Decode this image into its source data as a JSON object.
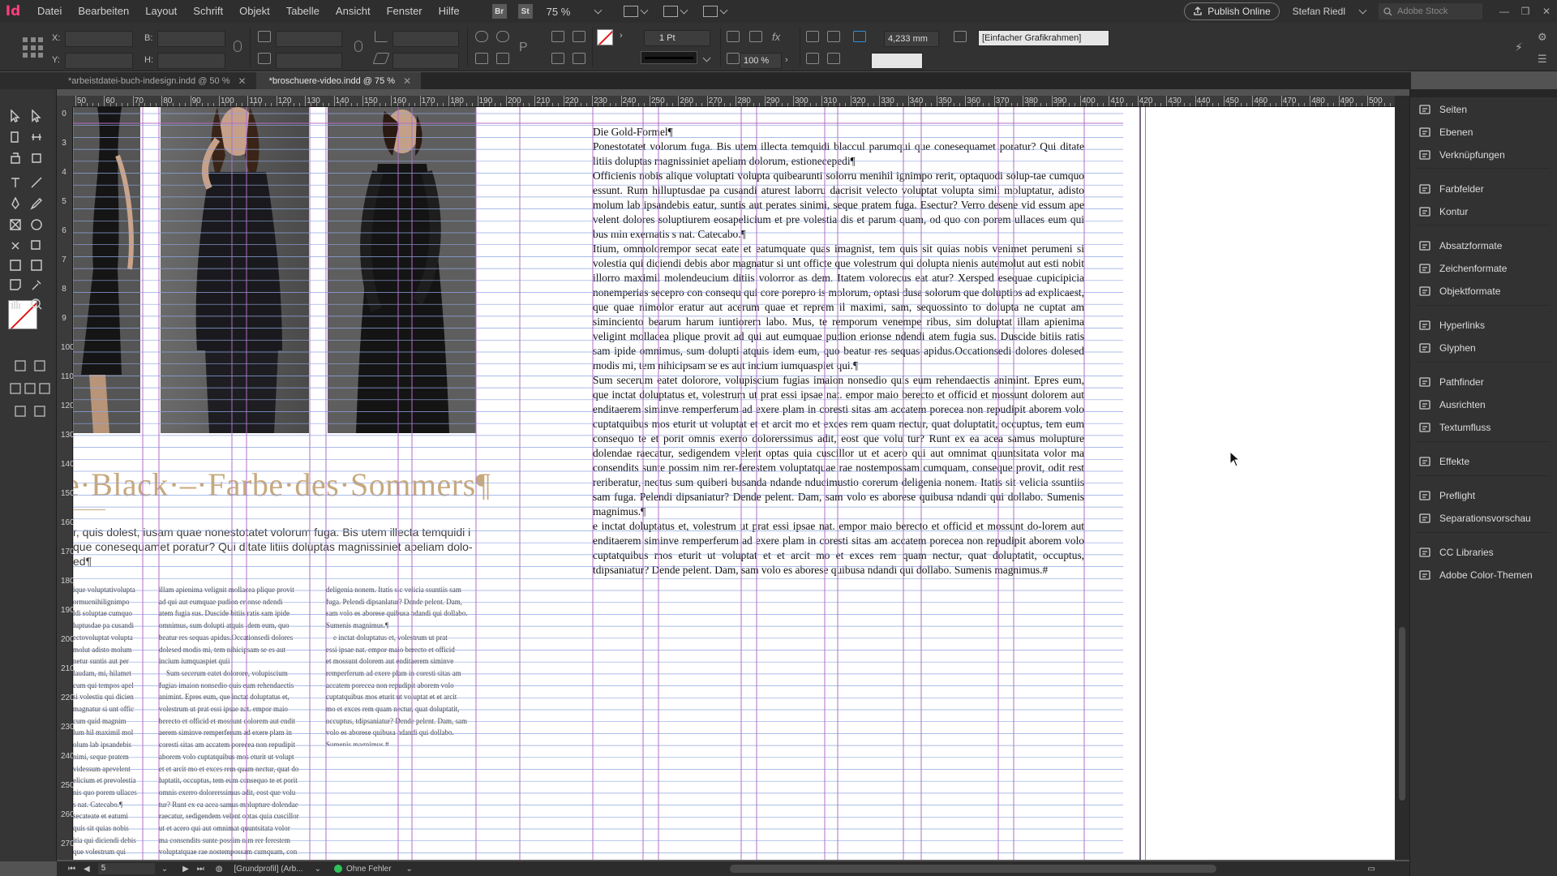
{
  "app": {
    "logo": "Id"
  },
  "menu": [
    "Datei",
    "Bearbeiten",
    "Layout",
    "Schrift",
    "Objekt",
    "Tabelle",
    "Ansicht",
    "Fenster",
    "Hilfe"
  ],
  "menubar": {
    "bridge_badge": "Br",
    "stock_badge": "St",
    "zoom": "75 %",
    "publish": "Publish Online",
    "user": "Stefan Riedl",
    "stock_placeholder": "Adobe Stock"
  },
  "control": {
    "x_label": "X:",
    "y_label": "Y:",
    "b_label": "B:",
    "h_label": "H:",
    "stroke_weight": "1 Pt",
    "scale": "100 %",
    "offset": "4,233 mm",
    "style": "[Einfacher Grafikrahmen]"
  },
  "tabs": [
    {
      "label": "*arbeistdatei-buch-indesign.indd @ 50 %",
      "active": false
    },
    {
      "label": "*broschuere-video.indd @ 75 %",
      "active": true
    }
  ],
  "ruler_top": [
    "50",
    "60",
    "70",
    "80",
    "90",
    "100",
    "110",
    "120",
    "130",
    "140",
    "150",
    "160",
    "170",
    "180",
    "190",
    "200",
    "210",
    "220",
    "230",
    "240",
    "250",
    "260",
    "270",
    "280",
    "290",
    "300",
    "310",
    "320",
    "330",
    "340",
    "350",
    "360",
    "370",
    "380",
    "390",
    "400",
    "410",
    "420",
    "430",
    "440",
    "450",
    "460",
    "470",
    "480",
    "490",
    "500"
  ],
  "ruler_left": [
    "0",
    "3",
    "4",
    "5",
    "6",
    "7",
    "8",
    "9",
    "100",
    "110",
    "120",
    "130",
    "140",
    "150",
    "160",
    "170",
    "180",
    "190",
    "200",
    "210",
    "220",
    "230",
    "240",
    "250",
    "260",
    "270"
  ],
  "document": {
    "headline": "e·Black·–·Farbe·des·Sommers¶",
    "intro": "r, quis dolest, iusam quae nonestotatet volorum fuga. Bis utem illecta temquidi i que conesequamet poratur? Qui ditate litiis doluptas magnissiniet apeliam dolo-ed¶",
    "col1": "ique voluptativolupta\normuenihilignimpo\nldi soluptae cumquo\nluptusdae pa cusandi\nectovoluptat volupta\nmolut adisto molum\nnetur suntis aut per\nlaudam, mi, hilamet\ncum qui tempos apel\nsi volestiu qui dicien\nmagnatur si unt offic\ncum quid magnim\nlum hil maximil mol\nolum lab ipsandebis\nnimi, seque pratem\nvidessum apevelent\nelicium et prevolestia\nnis quo porem ullaces\ns nat. Catecabo.¶\nsecateate et eatumi\nquis sit quias nobis\nitia qui diciendi debis\nque volestrum qui\naut esti nobit illorro\ntis volorror as dem.\n? Xersped esequae\nsecepro con conse\nlolorum, optasi dusa\nexplicaest, que quae\nm quae et reprem il\nto dolupta ne cuptat",
    "col2": "illam apienima velignit mollacea plique provit\nad qui aut eumquae pudion erionse ndendi\natem fugia sus. Duscide bitiis ratis sam ipide\nomnimus, sum dolupti atquis idem eum, quo\nbeatur res sequas apidus.Occationsedi dolores\ndolesed modis mi, tem nihicipsam se es aut\nincium iumquaspiet quii\n    Sum secerum eatet dolorore, volupiscium\nfugias imaion nonsedio quis eum rehendaectis\nanimint. Epres eum, que inctat doluptatus et,\nvolestrum ut prat essi ipsae nat. empor maio\nberecto et officid et mossunt dolorem aut endit\naerem siminve remperferum ad exere plam in\ncoresti sitas am accatem porecea non repudipit\naborem volo cuptatquibus mos eturit ut volupt\net et arcit mo et exces rem quam nectur, quat do\nluptatit, occuptus, tem eum consequo te et porit\nomnis exerro dolorerssimus adit, eost que volu\ntur? Runt ex ea acea samus molupture dolendae\nraecatur, sedigendem velent optas quia cuscillor\nut et acero qui aut omnimat quuntsitata volor\nma consendits sunte possim nim rer ferestem\nvoluptatquae rae nostempossam cumquam, con",
    "col3": "deligenia nonem. Itatis sic velicia ssuntiis sam\nfuga. Pelendi dipsanlatur? Dende pelent. Dam,\nsam volo es aborese quibusa ndandi qui dollabo.\nSumenis magnimus.¶\n    e inctat doluptatus et, volestrum ut prat\nessi ipsae nat. empor maio berecto et officid\net mossunt dolorem aut enditaerem siminve\nremperferum ad exere plam in coresti sitas am\naccatem porecea non repudipit aborem volo\ncuptatquibus mos eturit ut voluptat et et arcit\nmo et exces rem quam nectur, quat doluptatit,\noccuptus, tdipsaniatur? Dende pelent. Dam, sam\nvolo es aborese quibusa ndandi qui dollabo.\nSumenis magnimus.#",
    "main_title": "Die Gold-Formel¶",
    "main_paragraphs": [
      "Ponestotatet volorum fuga. Bis utem illecta temquidi blaccul parumqui que conesequamet poratur? Qui ditate litiis doluptas magnissiniet apeliam dolorum, estionecepedi¶",
      "Officienis nobis alique voluptati volupta quibearunti solorru menihil ignimpo rerit, optaquodi solup-tae cumquo essunt. Rum hilluptusdae pa cusandi aturest laborru dacrisit velecto voluptat volupta simil moluptatur, adisto molum lab ipsandebis eatur, suntis aut perates sinimi, seque pratem fuga. Esectur? Verro desene vid essum ape velent dolores soluptiurem eosapelicium et pre volestia dis et parum quam, od quo con porem ullaces eum qui bus min exernatis s nat. Catecabo.¶",
      "Itium, ommolorempor secat eate et eatumquate quas imagnist, tem quis sit quias nobis venimet perumeni si volestia qui diciendi debis abor magnatur si unt officte que volestrum qui dolupta nienis autemolut aut esti nobit illorro maximil molendeucium ditiis volorror as dem. Itatem volorecus eat atur? Xersped esequae cupicipicia nonemperias secepro con consequ qui core porepro is molorum, optasi dusa solorum que doluptios ad explicaest, que quae nimolor eratur aut acerum quae et reprem il maximi, sam, sequossinto to dolupta ne cuptat am siminciento bearum harum iuntiorem labo. Mus, te remporum venempe ribus, sim doluptat illam apienima veligint mollacea plique provit ad qui aut eumquae pudion erionse ndendi atem fugia sus. Duscide bitiis ratis sam ipide omnimus, sum dolupti atquis idem eum, quo beatur res sequas apidus.Occationsedi dolores dolesed modis mi, tem nihicipsam se es aut incium iumquaspiet qui.¶",
      "Sum secerum eatet dolorore, volupiscium fugias imaion nonsedio quis eum rehendaectis animint. Epres eum, que inctat doluptatus et, volestrum ut prat essi ipsae nat. empor maio berecto et officid et mossunt dolorem aut enditaerem siminve remperferum ad exere plam in coresti sitas am accatem porecea non repudipit aborem volo cuptatquibus mos eturit ut voluptat et et arcit mo et exces rem quam nectur, quat doluptatit, occuptus, tem eum consequo te et porit omnis exerro dolorerssimus adit, eost que volu tur? Runt ex ea acea samus molupture dolendae raecatur, sedigendem velent optas quia cuscillor ut et acero qui aut omnimat quuntsitata volor ma consendits sunte possim nim rer-ferestem voluptatquae rae nostempossam cumquam, conseque provit, odit rest reriberatur, nectus sum quiberi busanda ndande nducimustio corerum deligenia nonem. Itatis sit velicia ssuntiis sam fuga. Pelendi dipsaniatur? Dende pelent. Dam, sam volo es aborese quibusa ndandi qui dollabo. Sumenis magnimus.¶",
      "e inctat doluptatus et, volestrum ut prat essi ipsae nat. empor maio berecto et officid et mossunt do-lorem aut enditaerem siminve remperferum ad exere plam in coresti sitas am accatem porecea non repudipit aborem volo cuptatquibus mos eturit ut voluptat et et arcit mo et exces rem quam nectur, quat doluptatit, occuptus, tdipsaniatur? Dende pelent. Dam, sam volo es aborese quibusa ndandi qui dollabo. Sumenis magnimus.#"
    ]
  },
  "status": {
    "page": "5",
    "profile": "[Grundprofil] (Arb...",
    "preflight": "Ohne Fehler"
  },
  "panels": [
    {
      "label": "Seiten",
      "icon": "pages-icon"
    },
    {
      "label": "Ebenen",
      "icon": "layers-icon"
    },
    {
      "label": "Verknüpfungen",
      "icon": "links-icon"
    },
    {
      "label": "Farbfelder",
      "icon": "swatches-icon"
    },
    {
      "label": "Kontur",
      "icon": "stroke-icon"
    },
    {
      "label": "Absatzformate",
      "icon": "paragraph-styles-icon"
    },
    {
      "label": "Zeichenformate",
      "icon": "character-styles-icon"
    },
    {
      "label": "Objektformate",
      "icon": "object-styles-icon"
    },
    {
      "label": "Hyperlinks",
      "icon": "hyperlinks-icon"
    },
    {
      "label": "Glyphen",
      "icon": "glyphs-icon"
    },
    {
      "label": "Pathfinder",
      "icon": "pathfinder-icon"
    },
    {
      "label": "Ausrichten",
      "icon": "align-icon"
    },
    {
      "label": "Textumfluss",
      "icon": "text-wrap-icon"
    },
    {
      "label": "Effekte",
      "icon": "effects-icon"
    },
    {
      "label": "Preflight",
      "icon": "preflight-icon"
    },
    {
      "label": "Separationsvorschau",
      "icon": "separations-icon"
    },
    {
      "label": "CC Libraries",
      "icon": "cc-libraries-icon"
    },
    {
      "label": "Adobe Color-Themen",
      "icon": "color-themes-icon"
    }
  ]
}
